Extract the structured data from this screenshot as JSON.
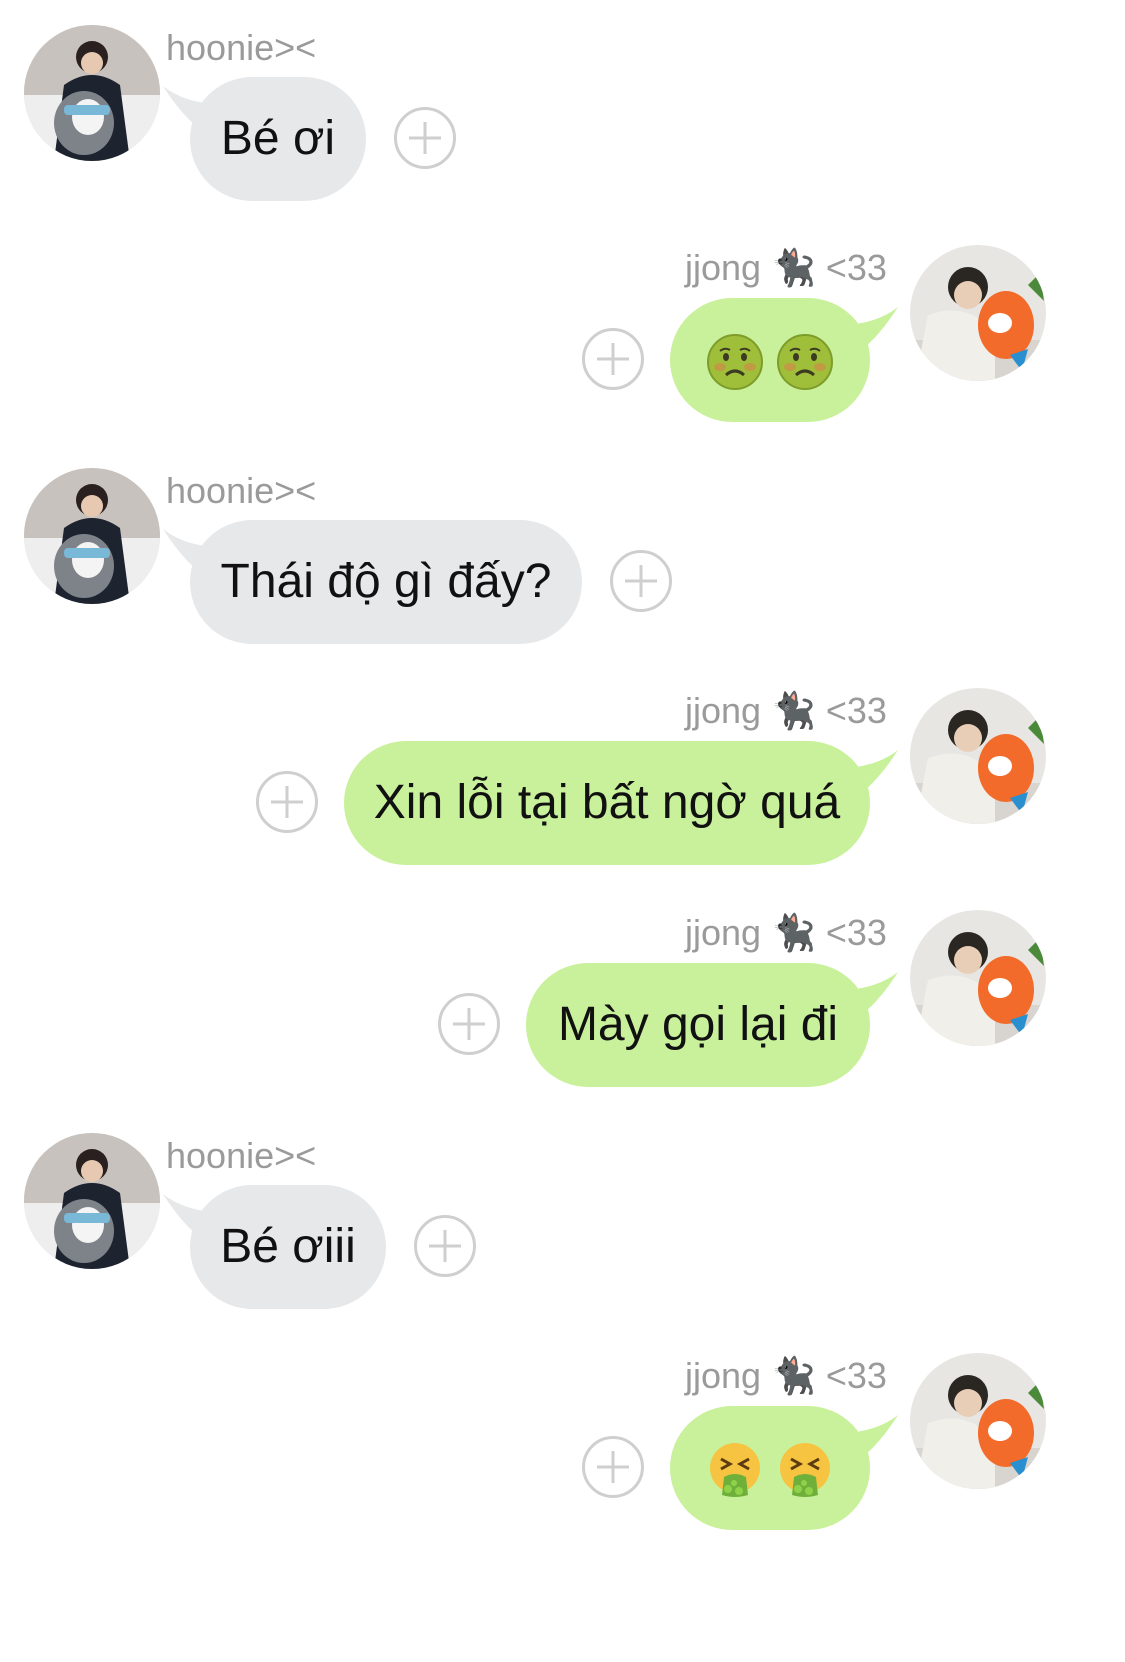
{
  "messages": [
    {
      "side": "in",
      "sender": "hoonie><",
      "text": "Bé ơi",
      "avatar": "penguin-avatar"
    },
    {
      "side": "out",
      "sender": "jjong 🐈‍⬛ <33",
      "emoji": [
        "nauseated-face",
        "nauseated-face"
      ],
      "avatar": "carrot-avatar"
    },
    {
      "side": "in",
      "sender": "hoonie><",
      "text": "Thái độ gì đấy?",
      "avatar": "penguin-avatar"
    },
    {
      "side": "out",
      "sender": "jjong 🐈‍⬛ <33",
      "text": "Xin lỗi tại bất ngờ quá",
      "avatar": "carrot-avatar"
    },
    {
      "side": "out",
      "sender": "jjong 🐈‍⬛ <33",
      "text": "Mày gọi lại đi",
      "avatar": "carrot-avatar"
    },
    {
      "side": "in",
      "sender": "hoonie><",
      "text": "Bé ơiii",
      "avatar": "penguin-avatar"
    },
    {
      "side": "out",
      "sender": "jjong 🐈‍⬛ <33",
      "emoji": [
        "vomiting-face",
        "vomiting-face"
      ],
      "avatar": "carrot-avatar"
    }
  ],
  "colors": {
    "incoming_bubble": "#e6e8ea",
    "outgoing_bubble": "#c9f19b",
    "sender_text": "#9a9a9a",
    "add_button": "#cfcfcf"
  },
  "icons": {
    "add_button": "plus-circle-icon"
  }
}
